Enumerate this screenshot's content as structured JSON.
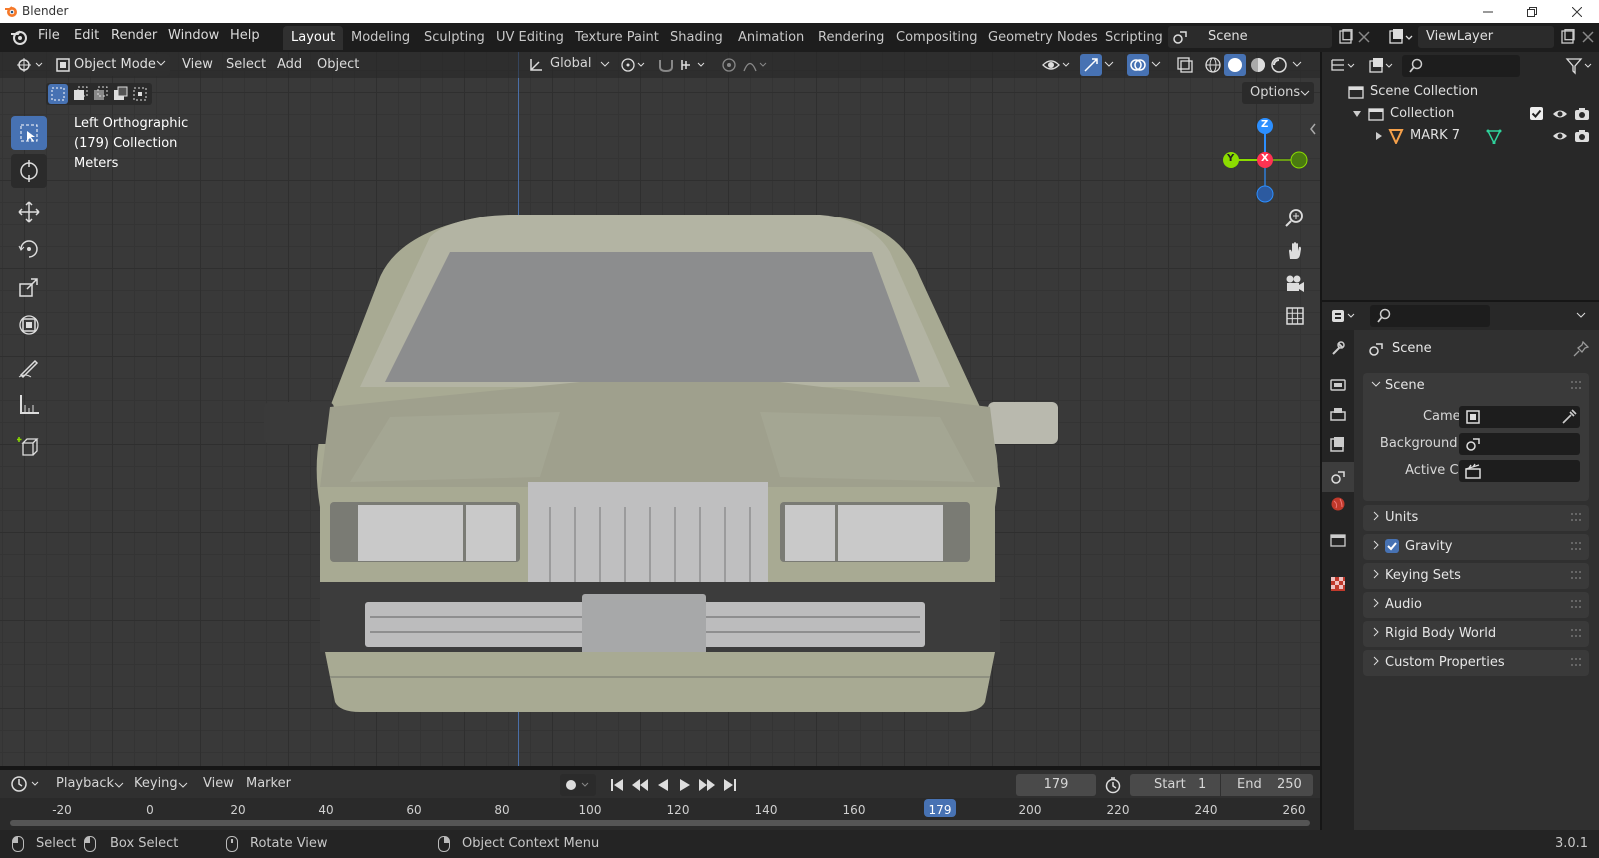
{
  "window": {
    "title": "Blender",
    "version": "3.0.1"
  },
  "menu": [
    "File",
    "Edit",
    "Render",
    "Window",
    "Help"
  ],
  "workspaces": [
    "Layout",
    "Modeling",
    "Sculpting",
    "UV Editing",
    "Texture Paint",
    "Shading",
    "Animation",
    "Rendering",
    "Compositing",
    "Geometry Nodes",
    "Scripting"
  ],
  "active_workspace": "Layout",
  "scene_name": "Scene",
  "view_layer": "ViewLayer",
  "viewport": {
    "mode": "Object Mode",
    "menus": [
      "View",
      "Select",
      "Add",
      "Object"
    ],
    "orientation": "Global",
    "options_label": "Options",
    "info": {
      "view": "Left Orthographic",
      "collection": "(179) Collection",
      "units": "Meters"
    },
    "gizmo": {
      "z": "Z",
      "y": "Y",
      "x": "X"
    }
  },
  "outliner": {
    "root": "Scene Collection",
    "collection": "Collection",
    "object": "MARK 7"
  },
  "properties": {
    "context": "Scene",
    "section": "Scene",
    "fields": {
      "camera": "Camera",
      "background": "Background ...",
      "active_clip": "Active Clip"
    },
    "panels": [
      "Units",
      "Gravity",
      "Keying Sets",
      "Audio",
      "Rigid Body World",
      "Custom Properties"
    ],
    "gravity_checked": true
  },
  "timeline": {
    "menus": [
      "Playback",
      "Keying",
      "View",
      "Marker"
    ],
    "current_frame": "179",
    "start_label": "Start",
    "start": "1",
    "end_label": "End",
    "end": "250",
    "ruler": [
      "-20",
      "0",
      "20",
      "40",
      "60",
      "80",
      "100",
      "120",
      "140",
      "160",
      "179",
      "200",
      "220",
      "240",
      "260"
    ]
  },
  "statusbar": {
    "select": "Select",
    "box_select": "Box Select",
    "rotate": "Rotate View",
    "context_menu": "Object Context Menu"
  },
  "colors": {
    "accent": "#4772b3",
    "car_body": "#a8aa93",
    "gizmo_x": "#ff3352",
    "gizmo_y": "#8bdc00",
    "gizmo_z": "#2c8fff"
  }
}
